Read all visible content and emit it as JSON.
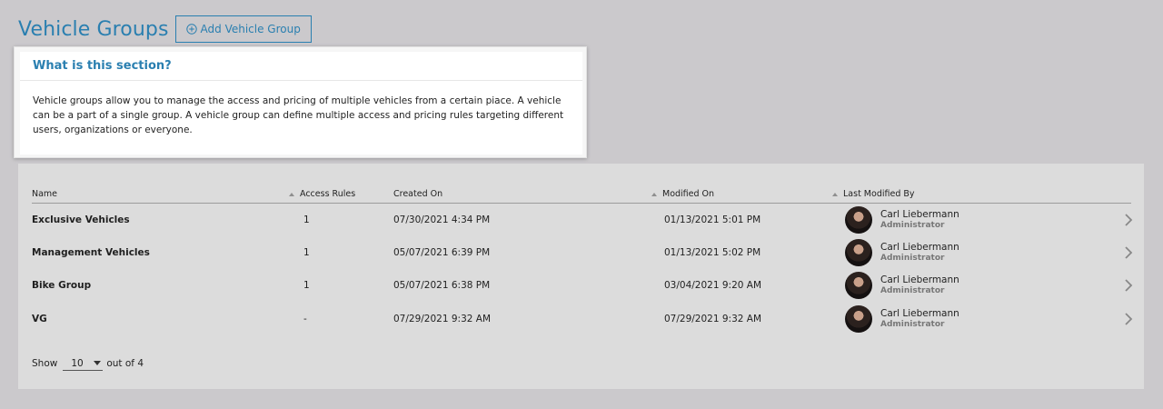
{
  "header": {
    "title": "Vehicle Groups",
    "add_button_label": "Add Vehicle Group",
    "add_icon": "plus-circle-icon"
  },
  "info": {
    "title": "What is this section?",
    "body": "Vehicle groups allow you to manage the access and pricing of multiple vehicles from a certain piace. A vehicle can be a part of a single group. A vehicle group can define multiple access and pricing rules targeting different users, organizations or everyone."
  },
  "table": {
    "columns": {
      "name": "Name",
      "access_rules": "Access Rules",
      "created_on": "Created On",
      "modified_on": "Modified On",
      "last_modified_by": "Last Modified By"
    },
    "rows": [
      {
        "name": "Exclusive Vehicles",
        "access_rules": "1",
        "created_on": "07/30/2021 4:34 PM",
        "modified_on": "01/13/2021 5:01 PM",
        "user": "Carl Liebermann",
        "role": "Administrator"
      },
      {
        "name": "Management Vehicles",
        "access_rules": "1",
        "created_on": "05/07/2021 6:39 PM",
        "modified_on": "01/13/2021 5:02 PM",
        "user": "Carl Liebermann",
        "role": "Administrator"
      },
      {
        "name": "Bike Group",
        "access_rules": "1",
        "created_on": "05/07/2021 6:38 PM",
        "modified_on": "03/04/2021 9:20 AM",
        "user": "Carl Liebermann",
        "role": "Administrator"
      },
      {
        "name": "VG",
        "access_rules": "-",
        "created_on": "07/29/2021 9:32 AM",
        "modified_on": "07/29/2021 9:32 AM",
        "user": "Carl Liebermann",
        "role": "Administrator"
      }
    ]
  },
  "pagination": {
    "show_label": "Show",
    "page_size": "10",
    "out_of_label": "out of 4"
  },
  "colors": {
    "accent": "#2a7fb0",
    "background": "#cbc9cc",
    "panel": "#dcdcdc"
  }
}
